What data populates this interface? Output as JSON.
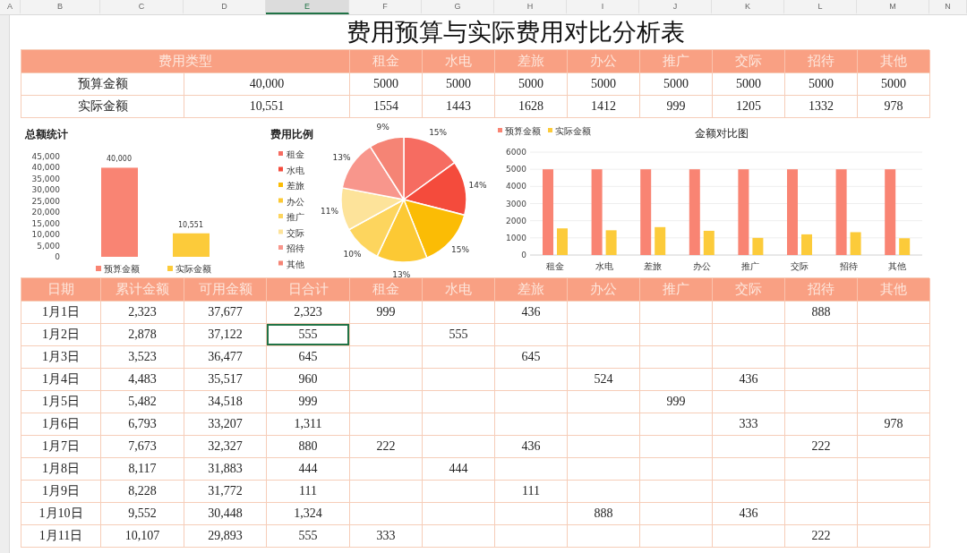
{
  "column_letters": [
    {
      "label": "A",
      "selected": false
    },
    {
      "label": "B",
      "selected": false
    },
    {
      "label": "C",
      "selected": false
    },
    {
      "label": "D",
      "selected": false
    },
    {
      "label": "E",
      "selected": true
    },
    {
      "label": "F",
      "selected": false
    },
    {
      "label": "G",
      "selected": false
    },
    {
      "label": "H",
      "selected": false
    },
    {
      "label": "I",
      "selected": false
    },
    {
      "label": "J",
      "selected": false
    },
    {
      "label": "K",
      "selected": false
    },
    {
      "label": "L",
      "selected": false
    },
    {
      "label": "M",
      "selected": false
    },
    {
      "label": "N",
      "selected": false
    }
  ],
  "title": "费用预算与实际费用对比分析表",
  "summary_table": {
    "type_label": "费用类型",
    "categories": [
      "租金",
      "水电",
      "差旅",
      "办公",
      "推广",
      "交际",
      "招待",
      "其他"
    ],
    "rows": [
      {
        "label": "预算金额",
        "total": "40,000",
        "values": [
          "5000",
          "5000",
          "5000",
          "5000",
          "5000",
          "5000",
          "5000",
          "5000"
        ]
      },
      {
        "label": "实际金额",
        "total": "10,551",
        "values": [
          "1554",
          "1443",
          "1628",
          "1412",
          "999",
          "1205",
          "1332",
          "978"
        ]
      }
    ]
  },
  "total_chart": {
    "chart_data": {
      "type": "bar",
      "title": "总额统计",
      "categories": [
        "预算金额",
        "实际金额"
      ],
      "values": [
        40000,
        10551
      ],
      "colors": [
        "#f98473",
        "#fccb3a"
      ],
      "ylim": [
        0,
        45000
      ],
      "yticks": [
        {
          "value": 0,
          "label": "0"
        },
        {
          "value": 5000,
          "label": "5,000"
        },
        {
          "value": 10000,
          "label": "10,000"
        },
        {
          "value": 15000,
          "label": "15,000"
        },
        {
          "value": 20000,
          "label": "20,000"
        },
        {
          "value": 25000,
          "label": "25,000"
        },
        {
          "value": 30000,
          "label": "30,000"
        },
        {
          "value": 35000,
          "label": "35,000"
        },
        {
          "value": 40000,
          "label": "40,000"
        },
        {
          "value": 45000,
          "label": "45,000"
        }
      ],
      "value_labels": [
        "40,000",
        "10,551"
      ]
    }
  },
  "ratio_chart": {
    "chart_data": {
      "type": "pie",
      "title": "费用比例",
      "categories": [
        "租金",
        "水电",
        "差旅",
        "办公",
        "推广",
        "交际",
        "招待",
        "其他"
      ],
      "values": [
        15,
        14,
        15,
        13,
        10,
        11,
        13,
        9
      ],
      "legend": "left",
      "colors": [
        "#f66c61",
        "#f44b3c",
        "#fbbc05",
        "#fcc934",
        "#fdd55e",
        "#fde39a",
        "#f8968c",
        "#f58475"
      ],
      "value_labels": [
        "15%",
        "14%",
        "15%",
        "13%",
        "10%",
        "11%",
        "13%",
        "9%"
      ]
    }
  },
  "compare_chart": {
    "chart_data": {
      "type": "bar",
      "title": "金额对比图",
      "categories": [
        "租金",
        "水电",
        "差旅",
        "办公",
        "推广",
        "交际",
        "招待",
        "其他"
      ],
      "series": [
        {
          "name": "预算金额",
          "color": "#f98473",
          "values": [
            5000,
            5000,
            5000,
            5000,
            5000,
            5000,
            5000,
            5000
          ]
        },
        {
          "name": "实际金额",
          "color": "#fccb3a",
          "values": [
            1554,
            1443,
            1628,
            1412,
            999,
            1205,
            1332,
            978
          ]
        }
      ],
      "ylim": [
        0,
        6000
      ],
      "legend": "top",
      "grid": true,
      "yticks": [
        0,
        1000,
        2000,
        3000,
        4000,
        5000,
        6000
      ]
    }
  },
  "daily_table": {
    "columns": [
      "日期",
      "累计金额",
      "可用金额",
      "日合计",
      "租金",
      "水电",
      "差旅",
      "办公",
      "推广",
      "交际",
      "招待",
      "其他"
    ],
    "rows": [
      {
        "selected": false,
        "cells": [
          "1月1日",
          "2,323",
          "37,677",
          "2,323",
          "999",
          null,
          "436",
          null,
          null,
          null,
          "888",
          null
        ]
      },
      {
        "selected": true,
        "cells": [
          "1月2日",
          "2,878",
          "37,122",
          "555",
          null,
          "555",
          null,
          null,
          null,
          null,
          null,
          null
        ]
      },
      {
        "selected": false,
        "cells": [
          "1月3日",
          "3,523",
          "36,477",
          "645",
          null,
          null,
          "645",
          null,
          null,
          null,
          null,
          null
        ]
      },
      {
        "selected": false,
        "cells": [
          "1月4日",
          "4,483",
          "35,517",
          "960",
          null,
          null,
          null,
          "524",
          null,
          "436",
          null,
          null
        ]
      },
      {
        "selected": false,
        "cells": [
          "1月5日",
          "5,482",
          "34,518",
          "999",
          null,
          null,
          null,
          null,
          "999",
          null,
          null,
          null
        ]
      },
      {
        "selected": false,
        "cells": [
          "1月6日",
          "6,793",
          "33,207",
          "1,311",
          null,
          null,
          null,
          null,
          null,
          "333",
          null,
          "978"
        ]
      },
      {
        "selected": false,
        "cells": [
          "1月7日",
          "7,673",
          "32,327",
          "880",
          "222",
          null,
          "436",
          null,
          null,
          null,
          "222",
          null
        ]
      },
      {
        "selected": false,
        "cells": [
          "1月8日",
          "8,117",
          "31,883",
          "444",
          null,
          "444",
          null,
          null,
          null,
          null,
          null,
          null
        ]
      },
      {
        "selected": false,
        "cells": [
          "1月9日",
          "8,228",
          "31,772",
          "111",
          null,
          null,
          "111",
          null,
          null,
          null,
          null,
          null
        ]
      },
      {
        "selected": false,
        "cells": [
          "1月10日",
          "9,552",
          "30,448",
          "1,324",
          null,
          null,
          null,
          "888",
          null,
          "436",
          null,
          null
        ]
      },
      {
        "selected": false,
        "cells": [
          "1月11日",
          "10,107",
          "29,893",
          "555",
          "333",
          null,
          null,
          null,
          null,
          null,
          "222",
          null
        ]
      }
    ]
  }
}
